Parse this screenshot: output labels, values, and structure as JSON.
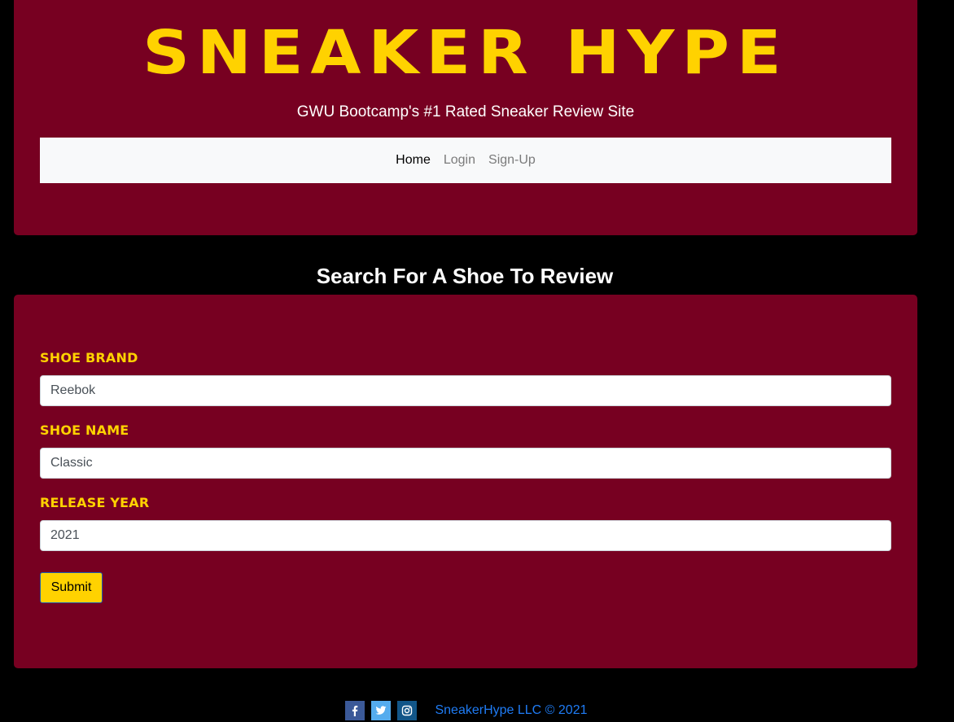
{
  "header": {
    "title": "SNEAKER HYPE",
    "tagline": "GWU Bootcamp's #1 Rated Sneaker Review Site"
  },
  "nav": {
    "items": [
      {
        "label": "Home",
        "active": true
      },
      {
        "label": "Login",
        "active": false
      },
      {
        "label": "Sign-Up",
        "active": false
      }
    ]
  },
  "search": {
    "heading": "Search For A Shoe To Review",
    "fields": [
      {
        "label": "SHOE BRAND",
        "value": "Reebok"
      },
      {
        "label": "SHOE NAME",
        "value": "Classic"
      },
      {
        "label": "RELEASE YEAR",
        "value": "2021"
      }
    ],
    "submit_label": "Submit"
  },
  "footer": {
    "social_icons": [
      "facebook-icon",
      "twitter-icon",
      "instagram-icon"
    ],
    "copyright": "SneakerHype LLC © 2021"
  },
  "colors": {
    "background": "#000000",
    "card": "#770021",
    "accent": "#ffd200",
    "navbar": "#f8f9fa",
    "link": "#1f7cf5"
  }
}
